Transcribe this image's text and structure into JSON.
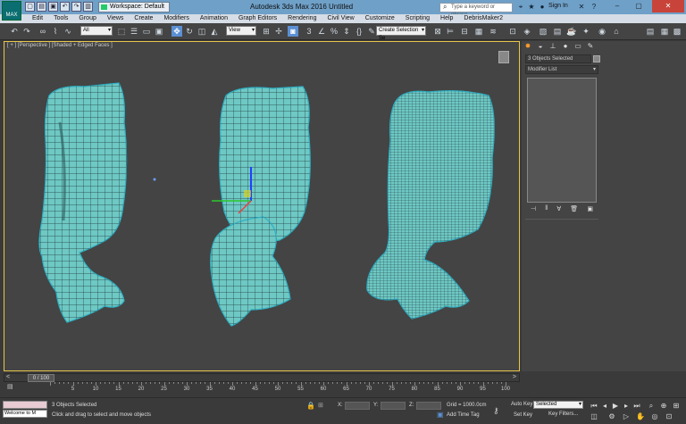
{
  "titlebar": {
    "app_title": "Autodesk 3ds Max 2016",
    "doc_title": "Untitled",
    "workspace": "Workspace: Default",
    "search_placeholder": "Type a keyword or phrase",
    "signin": "Sign In",
    "logo_text": "MAX"
  },
  "menu": [
    "Edit",
    "Tools",
    "Group",
    "Views",
    "Create",
    "Modifiers",
    "Animation",
    "Graph Editors",
    "Rendering",
    "Civil View",
    "Customize",
    "Scripting",
    "Help",
    "DebrisMaker2"
  ],
  "toolbar": {
    "filter": "All",
    "ref_coord": "View",
    "selection_set": "Create Selection Se"
  },
  "viewport": {
    "label": "[ + ] [Perspective ] [Shaded + Edged Faces ]"
  },
  "command_panel": {
    "selection": "3 Objects Selected",
    "modifier_list": "Modifier List"
  },
  "timeline": {
    "slider": "0 / 100",
    "ticks": [
      "5",
      "10",
      "15",
      "20",
      "25",
      "30",
      "35",
      "40",
      "45",
      "50",
      "55",
      "60",
      "65",
      "70",
      "75",
      "80",
      "85",
      "90",
      "95",
      "100"
    ]
  },
  "status": {
    "maxscript": "Welcome to M",
    "selection": "3 Objects Selected",
    "prompt": "Click and drag to select and move objects",
    "x_label": "X:",
    "y_label": "Y:",
    "z_label": "Z:",
    "grid": "Grid = 1000.0cm",
    "add_time_tag": "Add Time Tag",
    "auto_key": "Auto Key",
    "set_key": "Set Key",
    "selected": "Selected",
    "key_filters": "Key Filters..."
  },
  "colors": {
    "mesh": "#6ec8c4",
    "wire": "#1f3a3c",
    "viewport_bg": "#444444",
    "active_border": "#e8c64a",
    "titlebar": "#6fa0c8"
  }
}
